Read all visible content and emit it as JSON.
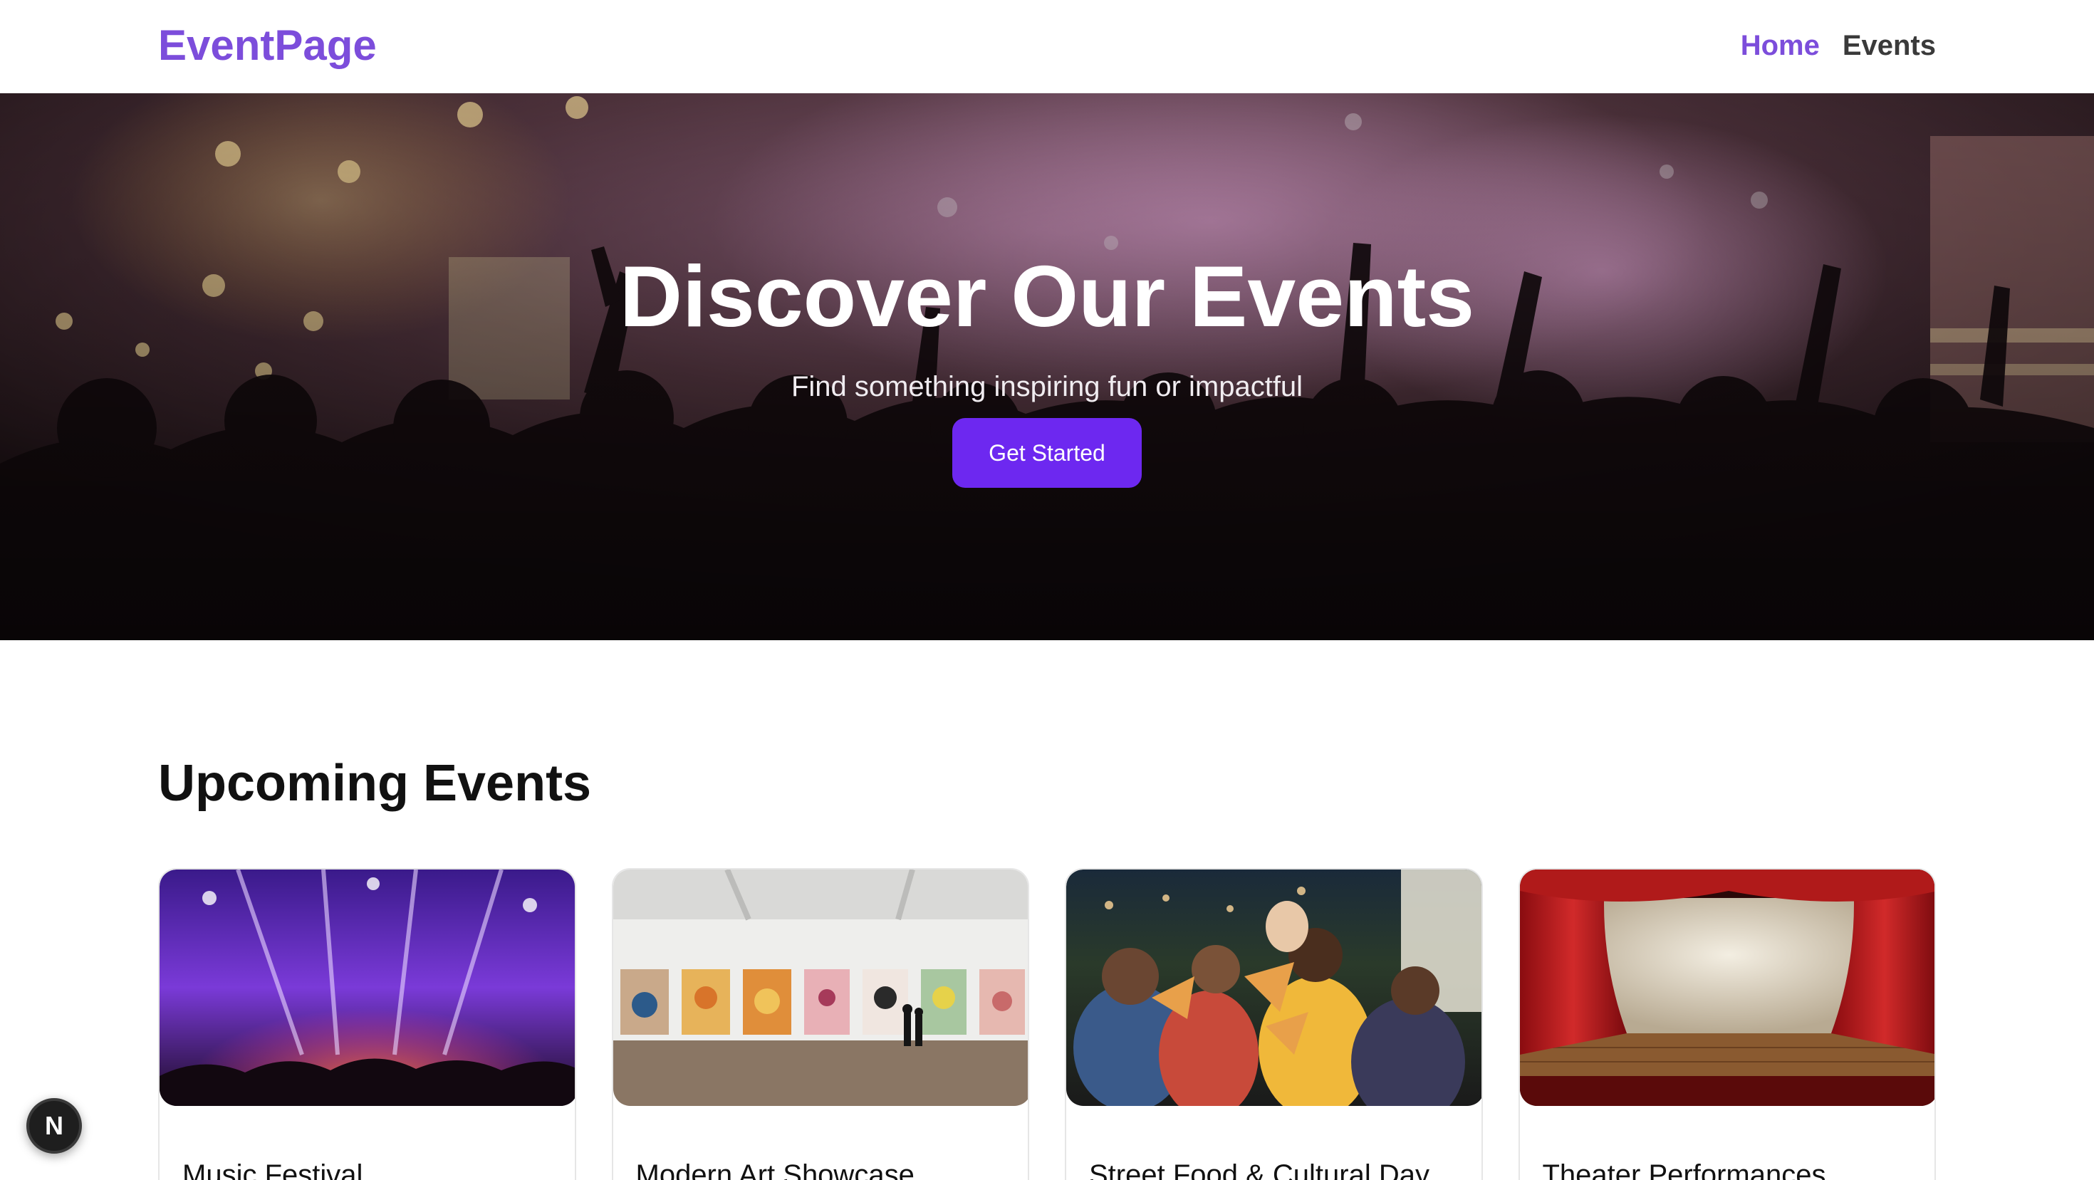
{
  "navbar": {
    "brand": "EventPage",
    "links": [
      {
        "label": "Home",
        "active": true
      },
      {
        "label": "Events",
        "active": false
      }
    ],
    "accent_color": "#7c4ddb"
  },
  "hero": {
    "title": "Discover Our Events",
    "subtitle": "Find something inspiring fun or impactful",
    "button_label": "Get Started",
    "button_color": "#6d28f0"
  },
  "section": {
    "title": "Upcoming Events"
  },
  "events": [
    {
      "title": "Music Festival",
      "image": "concert-stage-image"
    },
    {
      "title": "Modern Art Showcase",
      "image": "art-gallery-image"
    },
    {
      "title": "Street Food & Cultural Day",
      "image": "friends-eating-pizza-image"
    },
    {
      "title": "Theater Performances",
      "image": "theater-curtain-stage-image"
    }
  ],
  "floating_badge": {
    "icon": "n-logo-icon",
    "letter": "N"
  }
}
